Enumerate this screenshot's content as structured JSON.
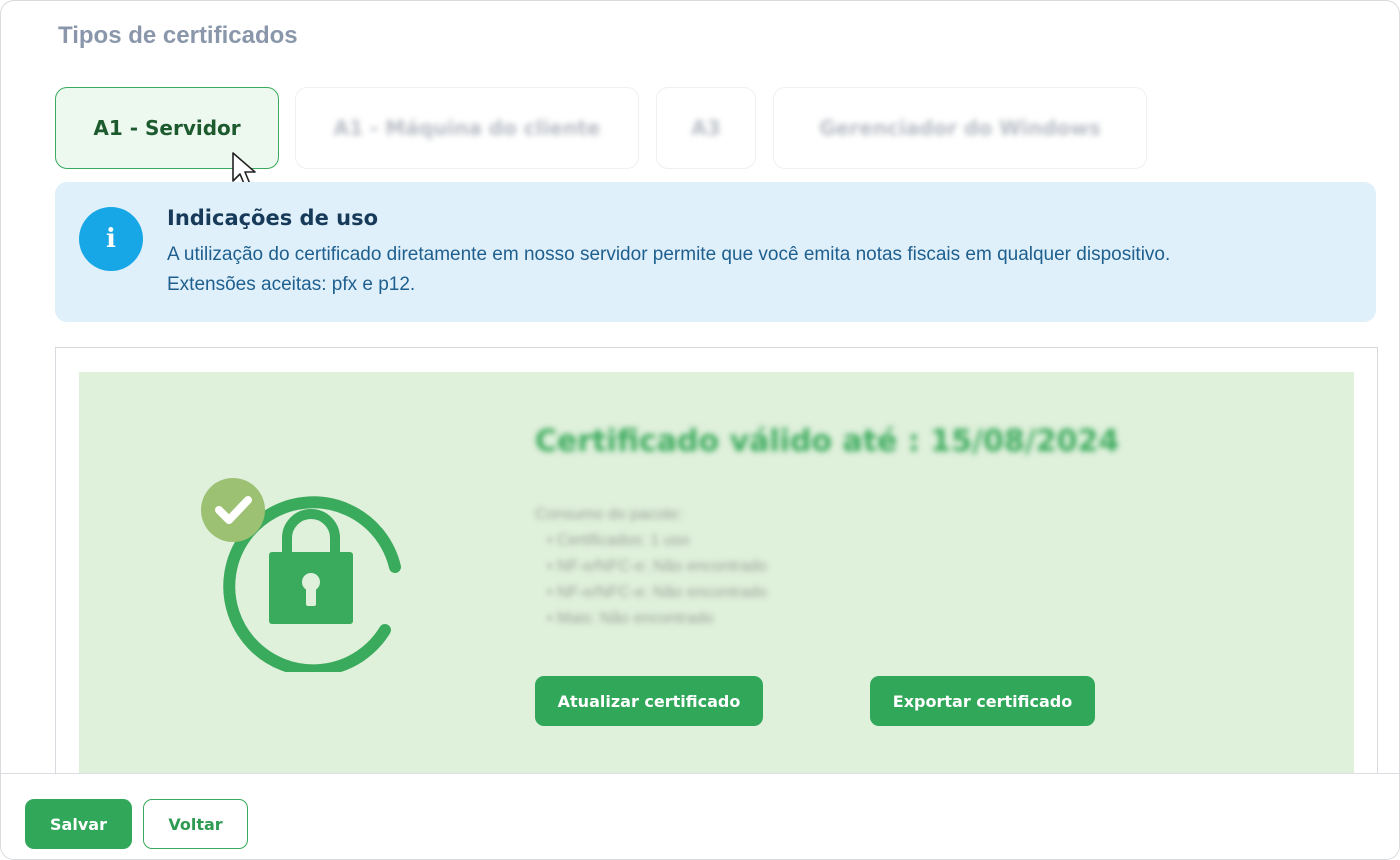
{
  "section": {
    "title": "Tipos de certificados"
  },
  "tabs": [
    {
      "label": "A1 - Servidor",
      "active": true
    },
    {
      "label": "A1 - Máquina do cliente",
      "active": false
    },
    {
      "label": "A3",
      "active": false
    },
    {
      "label": "Gerenciador do Windows",
      "active": false
    }
  ],
  "info": {
    "icon": "info-icon",
    "title": "Indicações de uso",
    "line1": "A utilização do certificado diretamente em nosso servidor permite que você emita notas fiscais em qualquer dispositivo.",
    "line2": "Extensões aceitas: pfx e p12."
  },
  "certificate": {
    "title": "Certificado válido até : 15/08/2024",
    "details_heading": "Consumo do pacote:",
    "details": [
      "• Certificados: 1 uso",
      "• NF-e/NFC-e: Não encontrado",
      "• NF-e/NFC-e: Não encontrado",
      "• Mais: Não encontrado"
    ],
    "update_label": "Atualizar certificado",
    "export_label": "Exportar certificado",
    "icon": "lock-check-icon"
  },
  "footer": {
    "save_label": "Salvar",
    "back_label": "Voltar"
  },
  "colors": {
    "accent": "#31a75a",
    "info_bg": "#dff0fb",
    "info_icon": "#17a7e6",
    "card_bg": "#dff0db",
    "check_badge": "#9dc173"
  }
}
